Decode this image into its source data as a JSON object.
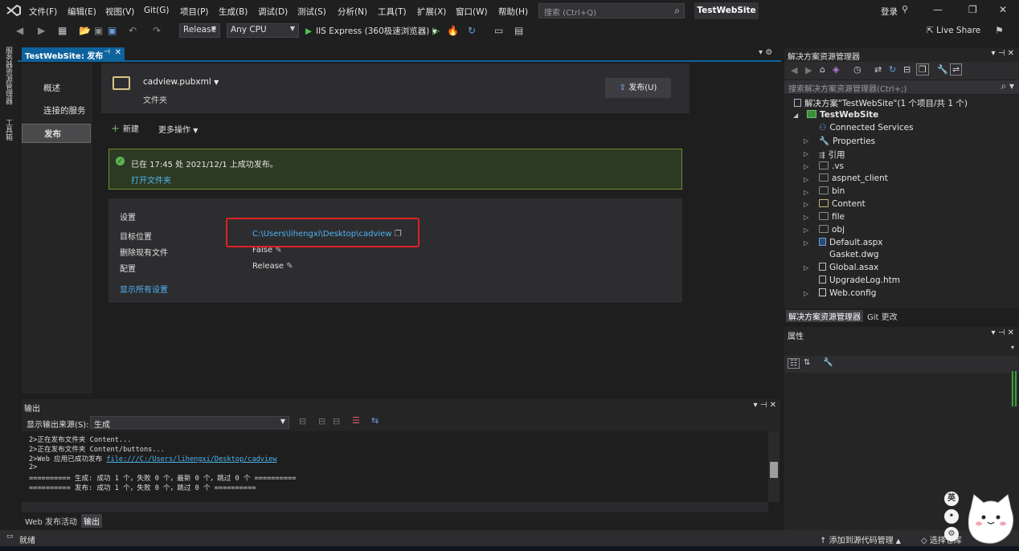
{
  "menubar": {
    "items": [
      "文件(F)",
      "编辑(E)",
      "视图(V)",
      "Git(G)",
      "项目(P)",
      "生成(B)",
      "调试(D)",
      "测试(S)",
      "分析(N)",
      "工具(T)",
      "扩展(X)",
      "窗口(W)",
      "帮助(H)"
    ],
    "search_placeholder": "搜索 (Ctrl+Q)",
    "solution_name": "TestWebSite",
    "login": "登录"
  },
  "toolbar": {
    "config": "Release",
    "platform": "Any CPU",
    "run_target": "IIS Express (360极速浏览器)",
    "live_share": "Live Share"
  },
  "left_strip": {
    "item1": "服务器资源管理器",
    "item2": "工具箱"
  },
  "document_tab": {
    "title": "TestWebSite: 发布"
  },
  "publish": {
    "nav": [
      "概述",
      "连接的服务",
      "发布"
    ],
    "profile_name": "cadview.pubxml",
    "profile_type": "文件夹",
    "publish_button": "发布(U)",
    "new_label": "新建",
    "more_ops": "更多操作",
    "success_message": "已在 17:45 处 2021/12/1 上成功发布。",
    "open_folder": "打开文件夹",
    "settings_title": "设置",
    "target_label": "目标位置",
    "target_value": "C:\\Users\\lihengxi\\Desktop\\cadview",
    "delete_label": "删除现有文件",
    "delete_value": "False",
    "config_label": "配置",
    "config_value": "Release",
    "show_all": "显示所有设置"
  },
  "output": {
    "title": "输出",
    "source_label": "显示输出来源(S):",
    "source_value": "生成",
    "lines": [
      "2>正在发布文件夹 Content...",
      "2>正在发布文件夹 Content/buttons...",
      "2>Web 应用已成功发布 ",
      "2>",
      "========== 生成: 成功 1 个，失败 0 个，最新 0 个，跳过 0 个 ==========",
      "========== 发布: 成功 1 个，失败 0 个，跳过 0 个 =========="
    ],
    "publish_link": "file:///C:/Users/lihengxi/Desktop/cadview",
    "tabs": [
      "Web 发布活动",
      "输出"
    ]
  },
  "solution_explorer": {
    "title": "解决方案资源管理器",
    "search_placeholder": "搜索解决方案资源管理器(Ctrl+;)",
    "solution_line": "解决方案\"TestWebSite\"(1 个项目/共 1 个)",
    "project": "TestWebSite",
    "items": [
      "Connected Services",
      "Properties",
      "引用",
      ".vs",
      "aspnet_client",
      "bin",
      "Content",
      "file",
      "obj",
      "Default.aspx",
      "Gasket.dwg",
      "Global.asax",
      "UpgradeLog.htm",
      "Web.config"
    ],
    "tabs": [
      "解决方案资源管理器",
      "Git 更改"
    ]
  },
  "properties": {
    "title": "属性"
  },
  "statusbar": {
    "ready": "就绪",
    "add_source": "添加到源代码管理",
    "select_repo": "选择仓库"
  },
  "ime": {
    "lang": "英"
  }
}
